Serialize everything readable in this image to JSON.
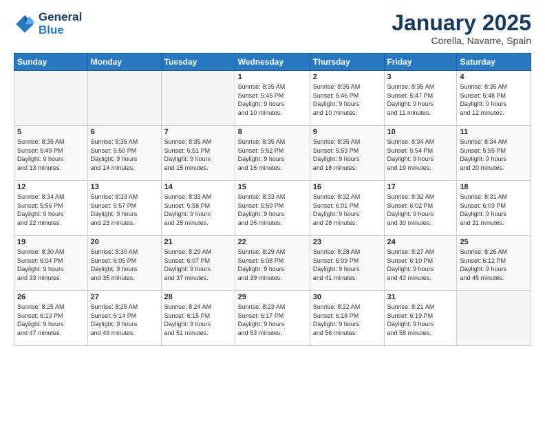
{
  "header": {
    "logo_line1": "General",
    "logo_line2": "Blue",
    "month": "January 2025",
    "location": "Corella, Navarre, Spain"
  },
  "weekdays": [
    "Sunday",
    "Monday",
    "Tuesday",
    "Wednesday",
    "Thursday",
    "Friday",
    "Saturday"
  ],
  "weeks": [
    [
      {
        "day": "",
        "info": ""
      },
      {
        "day": "",
        "info": ""
      },
      {
        "day": "",
        "info": ""
      },
      {
        "day": "1",
        "info": "Sunrise: 8:35 AM\nSunset: 5:45 PM\nDaylight: 9 hours\nand 10 minutes."
      },
      {
        "day": "2",
        "info": "Sunrise: 8:35 AM\nSunset: 5:46 PM\nDaylight: 9 hours\nand 10 minutes."
      },
      {
        "day": "3",
        "info": "Sunrise: 8:35 AM\nSunset: 5:47 PM\nDaylight: 9 hours\nand 11 minutes."
      },
      {
        "day": "4",
        "info": "Sunrise: 8:35 AM\nSunset: 5:48 PM\nDaylight: 9 hours\nand 12 minutes."
      }
    ],
    [
      {
        "day": "5",
        "info": "Sunrise: 8:35 AM\nSunset: 5:49 PM\nDaylight: 9 hours\nand 13 minutes."
      },
      {
        "day": "6",
        "info": "Sunrise: 8:35 AM\nSunset: 5:50 PM\nDaylight: 9 hours\nand 14 minutes."
      },
      {
        "day": "7",
        "info": "Sunrise: 8:35 AM\nSunset: 5:51 PM\nDaylight: 9 hours\nand 15 minutes."
      },
      {
        "day": "8",
        "info": "Sunrise: 8:35 AM\nSunset: 5:52 PM\nDaylight: 9 hours\nand 16 minutes."
      },
      {
        "day": "9",
        "info": "Sunrise: 8:35 AM\nSunset: 5:53 PM\nDaylight: 9 hours\nand 18 minutes."
      },
      {
        "day": "10",
        "info": "Sunrise: 8:34 AM\nSunset: 5:54 PM\nDaylight: 9 hours\nand 19 minutes."
      },
      {
        "day": "11",
        "info": "Sunrise: 8:34 AM\nSunset: 5:55 PM\nDaylight: 9 hours\nand 20 minutes."
      }
    ],
    [
      {
        "day": "12",
        "info": "Sunrise: 8:34 AM\nSunset: 5:56 PM\nDaylight: 9 hours\nand 22 minutes."
      },
      {
        "day": "13",
        "info": "Sunrise: 8:33 AM\nSunset: 5:57 PM\nDaylight: 9 hours\nand 23 minutes."
      },
      {
        "day": "14",
        "info": "Sunrise: 8:33 AM\nSunset: 5:58 PM\nDaylight: 9 hours\nand 25 minutes."
      },
      {
        "day": "15",
        "info": "Sunrise: 8:33 AM\nSunset: 5:59 PM\nDaylight: 9 hours\nand 26 minutes."
      },
      {
        "day": "16",
        "info": "Sunrise: 8:32 AM\nSunset: 6:01 PM\nDaylight: 9 hours\nand 28 minutes."
      },
      {
        "day": "17",
        "info": "Sunrise: 8:32 AM\nSunset: 6:02 PM\nDaylight: 9 hours\nand 30 minutes."
      },
      {
        "day": "18",
        "info": "Sunrise: 8:31 AM\nSunset: 6:03 PM\nDaylight: 9 hours\nand 31 minutes."
      }
    ],
    [
      {
        "day": "19",
        "info": "Sunrise: 8:30 AM\nSunset: 6:04 PM\nDaylight: 9 hours\nand 33 minutes."
      },
      {
        "day": "20",
        "info": "Sunrise: 8:30 AM\nSunset: 6:05 PM\nDaylight: 9 hours\nand 35 minutes."
      },
      {
        "day": "21",
        "info": "Sunrise: 8:29 AM\nSunset: 6:07 PM\nDaylight: 9 hours\nand 37 minutes."
      },
      {
        "day": "22",
        "info": "Sunrise: 8:29 AM\nSunset: 6:08 PM\nDaylight: 9 hours\nand 39 minutes."
      },
      {
        "day": "23",
        "info": "Sunrise: 8:28 AM\nSunset: 6:09 PM\nDaylight: 9 hours\nand 41 minutes."
      },
      {
        "day": "24",
        "info": "Sunrise: 8:27 AM\nSunset: 6:10 PM\nDaylight: 9 hours\nand 43 minutes."
      },
      {
        "day": "25",
        "info": "Sunrise: 8:26 AM\nSunset: 6:12 PM\nDaylight: 9 hours\nand 45 minutes."
      }
    ],
    [
      {
        "day": "26",
        "info": "Sunrise: 8:25 AM\nSunset: 6:13 PM\nDaylight: 9 hours\nand 47 minutes."
      },
      {
        "day": "27",
        "info": "Sunrise: 8:25 AM\nSunset: 6:14 PM\nDaylight: 9 hours\nand 49 minutes."
      },
      {
        "day": "28",
        "info": "Sunrise: 8:24 AM\nSunset: 6:15 PM\nDaylight: 9 hours\nand 51 minutes."
      },
      {
        "day": "29",
        "info": "Sunrise: 8:23 AM\nSunset: 6:17 PM\nDaylight: 9 hours\nand 53 minutes."
      },
      {
        "day": "30",
        "info": "Sunrise: 8:22 AM\nSunset: 6:18 PM\nDaylight: 9 hours\nand 56 minutes."
      },
      {
        "day": "31",
        "info": "Sunrise: 8:21 AM\nSunset: 6:19 PM\nDaylight: 9 hours\nand 58 minutes."
      },
      {
        "day": "",
        "info": ""
      }
    ]
  ]
}
